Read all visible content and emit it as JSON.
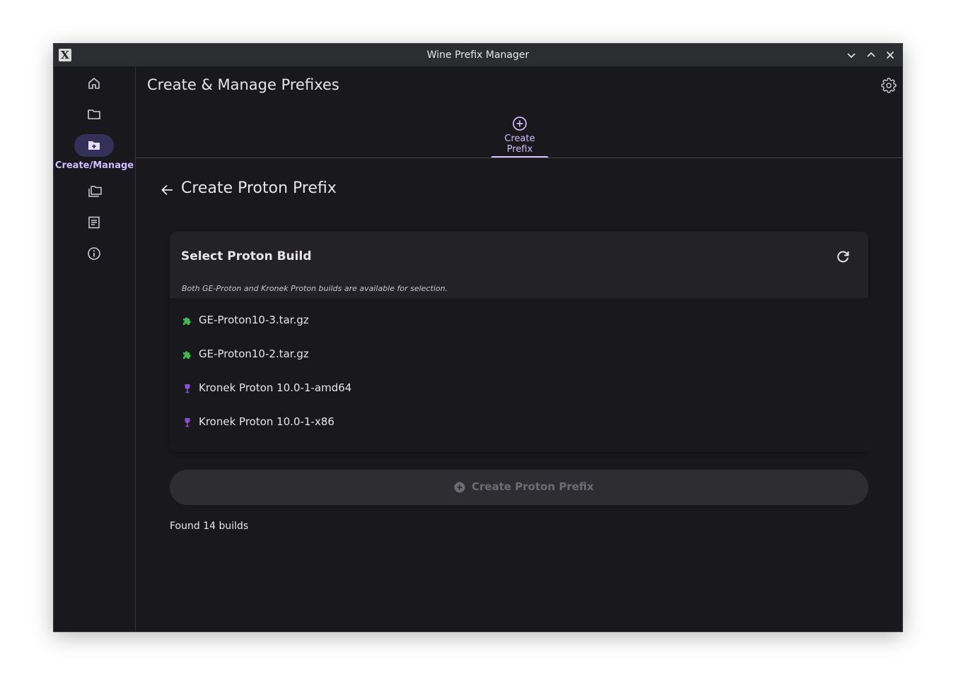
{
  "window": {
    "title": "Wine Prefix Manager",
    "app_icon": "X"
  },
  "rail": {
    "items": [
      {
        "icon": "home-icon"
      },
      {
        "icon": "folder-icon"
      },
      {
        "icon": "create-folder-icon",
        "label": "Create/Manage",
        "active": true
      },
      {
        "icon": "library-icon"
      },
      {
        "icon": "list-icon"
      },
      {
        "icon": "info-icon"
      }
    ]
  },
  "header": {
    "title": "Create & Manage Prefixes"
  },
  "tabs": [
    {
      "label": "Create Prefix",
      "icon": "add-circle-icon",
      "active": true
    }
  ],
  "subpage": {
    "title": "Create Proton Prefix"
  },
  "card": {
    "title": "Select Proton Build",
    "hint": "Both GE-Proton and Kronek Proton builds are available for selection.",
    "builds": [
      {
        "label": "GE-Proton10-3.tar.gz",
        "icon": "puzzle-icon"
      },
      {
        "label": "GE-Proton10-2.tar.gz",
        "icon": "puzzle-icon"
      },
      {
        "label": "Kronek Proton 10.0-1-amd64",
        "icon": "wine-glass-icon"
      },
      {
        "label": "Kronek Proton 10.0-1-x86",
        "icon": "wine-glass-icon"
      }
    ]
  },
  "create_button": {
    "label": "Create Proton Prefix",
    "enabled": false
  },
  "status": "Found 14 builds",
  "colors": {
    "background": "#19181d",
    "accent": "#cfbdfe",
    "ge_icon": "#3fb950",
    "kronek_icon": "#8a4fd8"
  }
}
